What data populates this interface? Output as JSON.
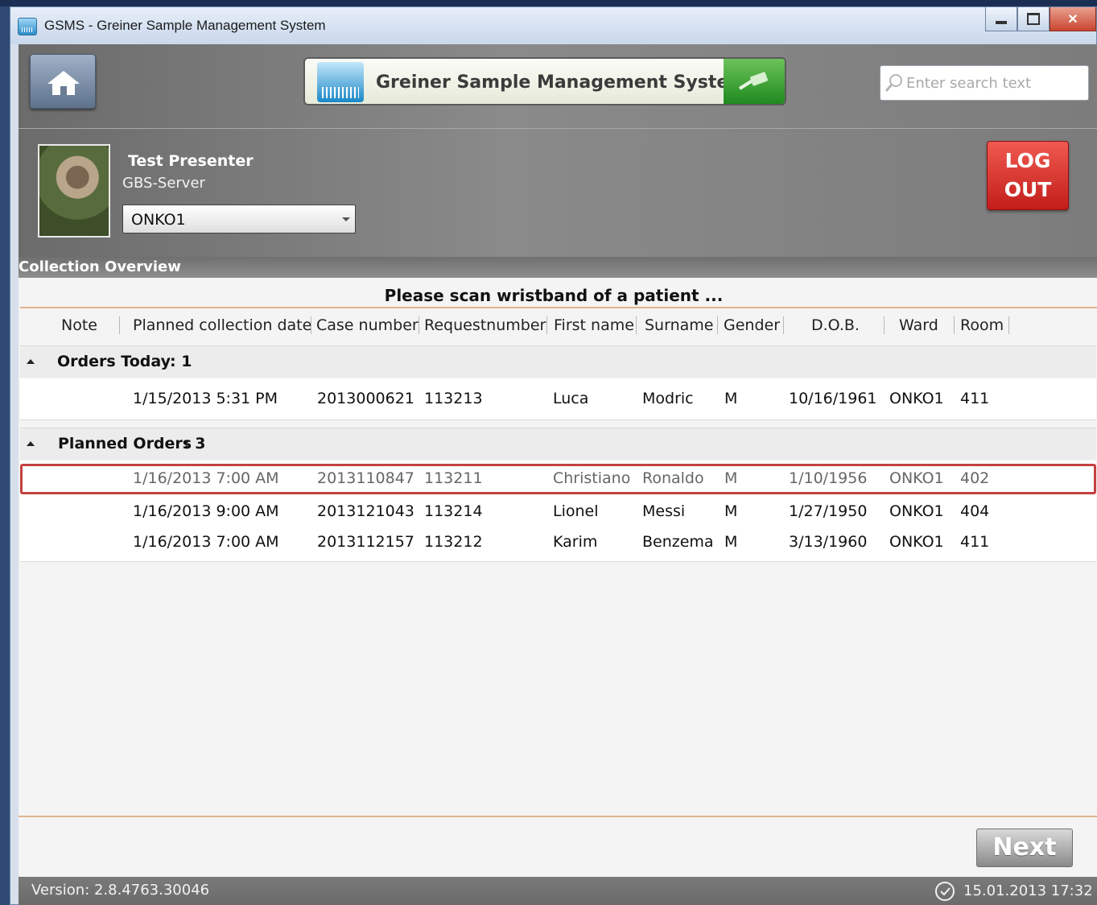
{
  "window": {
    "title": "GSMS - Greiner Sample Management System"
  },
  "header": {
    "banner_title": "Greiner Sample Management System",
    "search_placeholder": "Enter search text",
    "user_name": "Test Presenter",
    "server": "GBS-Server",
    "ward_selected": "ONKO1",
    "logout_line1": "LOG",
    "logout_line2": "OUT"
  },
  "section": {
    "title": "Collection Overview"
  },
  "main": {
    "prompt": "Please scan wristband of a patient ...",
    "columns": [
      "Note",
      "Planned collection date",
      "Case number",
      "Requestnumber",
      "First name",
      "Surname",
      "Gender",
      "D.O.B.",
      "Ward",
      "Room"
    ],
    "groups": [
      {
        "label": "Orders Today",
        "count": ": 1",
        "rows": [
          {
            "date": "1/15/2013 5:31 PM",
            "case": "2013000621",
            "request": "113213",
            "first": "Luca",
            "surname": "Modric",
            "gender": "M",
            "dob": "10/16/1961",
            "ward": "ONKO1",
            "room": "411"
          }
        ]
      },
      {
        "label": "Planned Orders",
        "count": ": 3",
        "rows": [
          {
            "date": "1/16/2013 7:00 AM",
            "case": "2013110847",
            "request": "113211",
            "first": "Christiano",
            "surname": "Ronaldo",
            "gender": "M",
            "dob": "1/10/1956",
            "ward": "ONKO1",
            "room": "402"
          },
          {
            "date": "1/16/2013 9:00 AM",
            "case": "2013121043",
            "request": "113214",
            "first": "Lionel",
            "surname": "Messi",
            "gender": "M",
            "dob": "1/27/1950",
            "ward": "ONKO1",
            "room": "404"
          },
          {
            "date": "1/16/2013 7:00 AM",
            "case": "2013112157",
            "request": "113212",
            "first": "Karim",
            "surname": "Benzema",
            "gender": "M",
            "dob": "3/13/1960",
            "ward": "ONKO1",
            "room": "411"
          }
        ]
      }
    ],
    "next_label": "Next"
  },
  "status": {
    "version": "Version: 2.8.4763.30046",
    "datetime": "15.01.2013 17:32"
  }
}
